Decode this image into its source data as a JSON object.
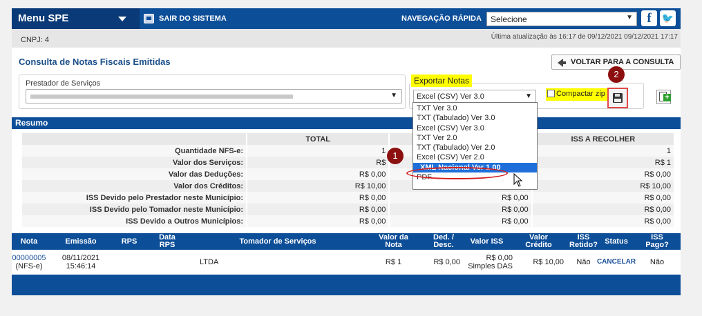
{
  "topbar": {
    "menu_label": "Menu SPE",
    "sair_label": "SAIR DO SISTEMA",
    "nav_label": "NAVEGAÇÃO RÁPIDA",
    "nav_select_value": "Selecione",
    "facebook_glyph": "f",
    "twitter_glyph": "🐦"
  },
  "infobar": {
    "cnpj": "CNPJ: 4",
    "ultima": "Última atualização às 16:17 de 09/12/2021  09/12/2021 17:17"
  },
  "page": {
    "title": "Consulta de Notas Fiscais Emitidas",
    "voltar_label": "VOLTAR PARA A CONSULTA"
  },
  "prestador": {
    "label": "Prestador de Serviços"
  },
  "exportar": {
    "legend": "Exportar Notas",
    "selected": "Excel (CSV) Ver 3.0",
    "compactar_label": "Compactar zip",
    "options": [
      "TXT Ver 3.0",
      "TXT (Tabulado) Ver 3.0",
      "Excel (CSV) Ver 3.0",
      "TXT Ver 2.0",
      "TXT (Tabulado) Ver 2.0",
      "Excel (CSV) Ver 2.0",
      "XML Nacional Ver 1.00",
      "PDF"
    ],
    "highlighted_option": "XML Nacional Ver 1.00"
  },
  "badges": {
    "one": "1",
    "two": "2"
  },
  "resumo": {
    "title": "Resumo",
    "col_total": "TOTAL",
    "col_iss_recolher": "ISS A RECOLHER",
    "rows": [
      {
        "label": "Quantidade NFS-e:",
        "total": "1",
        "mid": "",
        "recolher": "1"
      },
      {
        "label": "Valor dos Serviços:",
        "total": "R$",
        "mid": "",
        "recolher": "R$ 1"
      },
      {
        "label": "Valor das Deduções:",
        "total": "R$ 0,00",
        "mid": "",
        "recolher": "R$ 0,00"
      },
      {
        "label": "Valor dos Créditos:",
        "total": "R$ 10,00",
        "mid": "R$ 0,00",
        "recolher": "R$ 10,00"
      },
      {
        "label": "ISS Devido pelo Prestador neste Município:",
        "total": "R$ 0,00",
        "mid": "R$ 0,00",
        "recolher": "R$ 0,00"
      },
      {
        "label": "ISS Devido pelo Tomador neste Município:",
        "total": "R$ 0,00",
        "mid": "R$ 0,00",
        "recolher": "R$ 0,00"
      },
      {
        "label": "ISS Devido a Outros Municípios:",
        "total": "R$ 0,00",
        "mid": "R$ 0,00",
        "recolher": "R$ 0,00"
      }
    ]
  },
  "notas": {
    "headers": [
      "Nota",
      "Emissão",
      "RPS",
      "Data RPS",
      "Tomador de Serviços",
      "Valor da Nota",
      "Ded. / Desc.",
      "Valor ISS",
      "Valor Crédito",
      "ISS Retido?",
      "Status",
      "ISS Pago?"
    ],
    "row": {
      "nota": "00000005",
      "nota_tipo": "(NFS-e)",
      "emissao_data": "08/11/2021",
      "emissao_hora": "15:46:14",
      "rps": "",
      "data_rps": "",
      "tomador": "LTDA",
      "valor_nota": "R$ 1",
      "ded_desc": "R$ 0,00",
      "valor_iss": "R$ 0,00",
      "valor_iss_sub": "Simples DAS",
      "valor_credito": "R$ 10,00",
      "iss_retido": "Não",
      "status": "CANCELAR",
      "iss_pago": "Não"
    }
  },
  "colors": {
    "brand": "#0d4e98",
    "highlight": "#ffff00",
    "badge": "#8c1010",
    "selection": "#1e6fd9"
  }
}
